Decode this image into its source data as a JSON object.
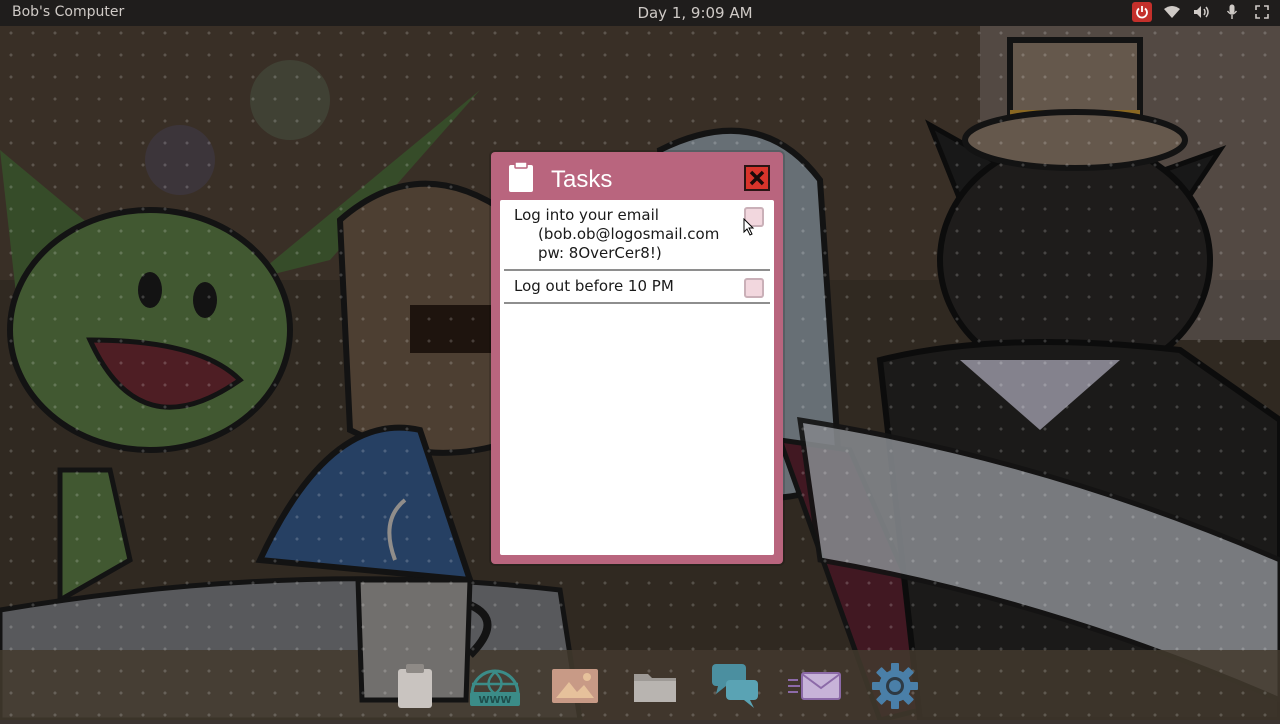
{
  "topbar": {
    "computer_name": "Bob's Computer",
    "clock": "Day 1, 9:09 AM",
    "tray_icons": [
      "power-icon",
      "wifi-icon",
      "volume-icon",
      "microphone-icon",
      "fullscreen-icon"
    ]
  },
  "tasks_window": {
    "title": "Tasks",
    "tasks": [
      {
        "title": "Log into your email",
        "detail_line1": "(bob.ob@logosmail.com",
        "detail_line2": "pw: 8OverCer8!)",
        "done": false
      },
      {
        "title": "Log out before 10 PM",
        "done": false
      }
    ]
  },
  "dock": {
    "items": [
      "tasks-icon",
      "browser-icon",
      "photos-icon",
      "files-icon",
      "chat-icon",
      "mail-icon",
      "settings-icon"
    ]
  },
  "colors": {
    "window_frame": "#b9657e",
    "close_button": "#d8342b",
    "topbar": "#1f1d1c"
  }
}
